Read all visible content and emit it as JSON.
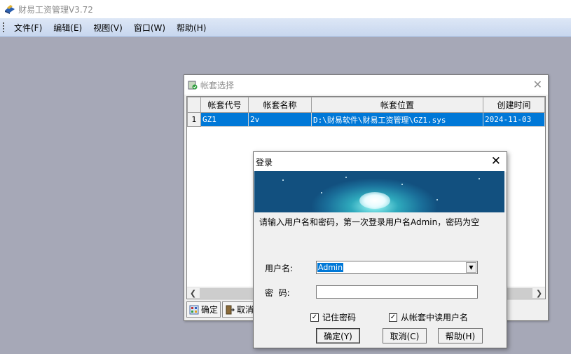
{
  "app": {
    "title": "财易工资管理V3.72"
  },
  "menu": {
    "items": [
      {
        "label": "文件(F)"
      },
      {
        "label": "编辑(E)"
      },
      {
        "label": "视图(V)"
      },
      {
        "label": "窗口(W)"
      },
      {
        "label": "帮助(H)"
      }
    ]
  },
  "account_window": {
    "title": "帐套选择",
    "columns": [
      "帐套代号",
      "帐套名称",
      "帐套位置",
      "创建时间"
    ],
    "rows": [
      {
        "num": "1",
        "code": "GZ1",
        "name": "2v",
        "path": "D:\\财易软件\\财易工资管理\\GZ1.sys",
        "created": "2024-11-03"
      }
    ],
    "toolbar": {
      "ok_label": "确定",
      "cancel_label": "取消"
    }
  },
  "login": {
    "title": "登录",
    "message": "请输入用户名和密码，第一次登录用户名Admin，密码为空",
    "username_label": "用户名:",
    "username_value": "Admin",
    "password_label": "密  码:",
    "password_value": "",
    "remember_label": "记住密码",
    "remember_checked": "✓",
    "read_user_label": "从帐套中读用户名",
    "read_user_checked": "✓",
    "ok_label": "确定(Y)",
    "cancel_label": "取消(C)",
    "help_label": "帮助(H)"
  },
  "colors": {
    "selection": "#0078d7",
    "workspace": "#a6a8b7",
    "menubar": "#c7d6ee"
  }
}
